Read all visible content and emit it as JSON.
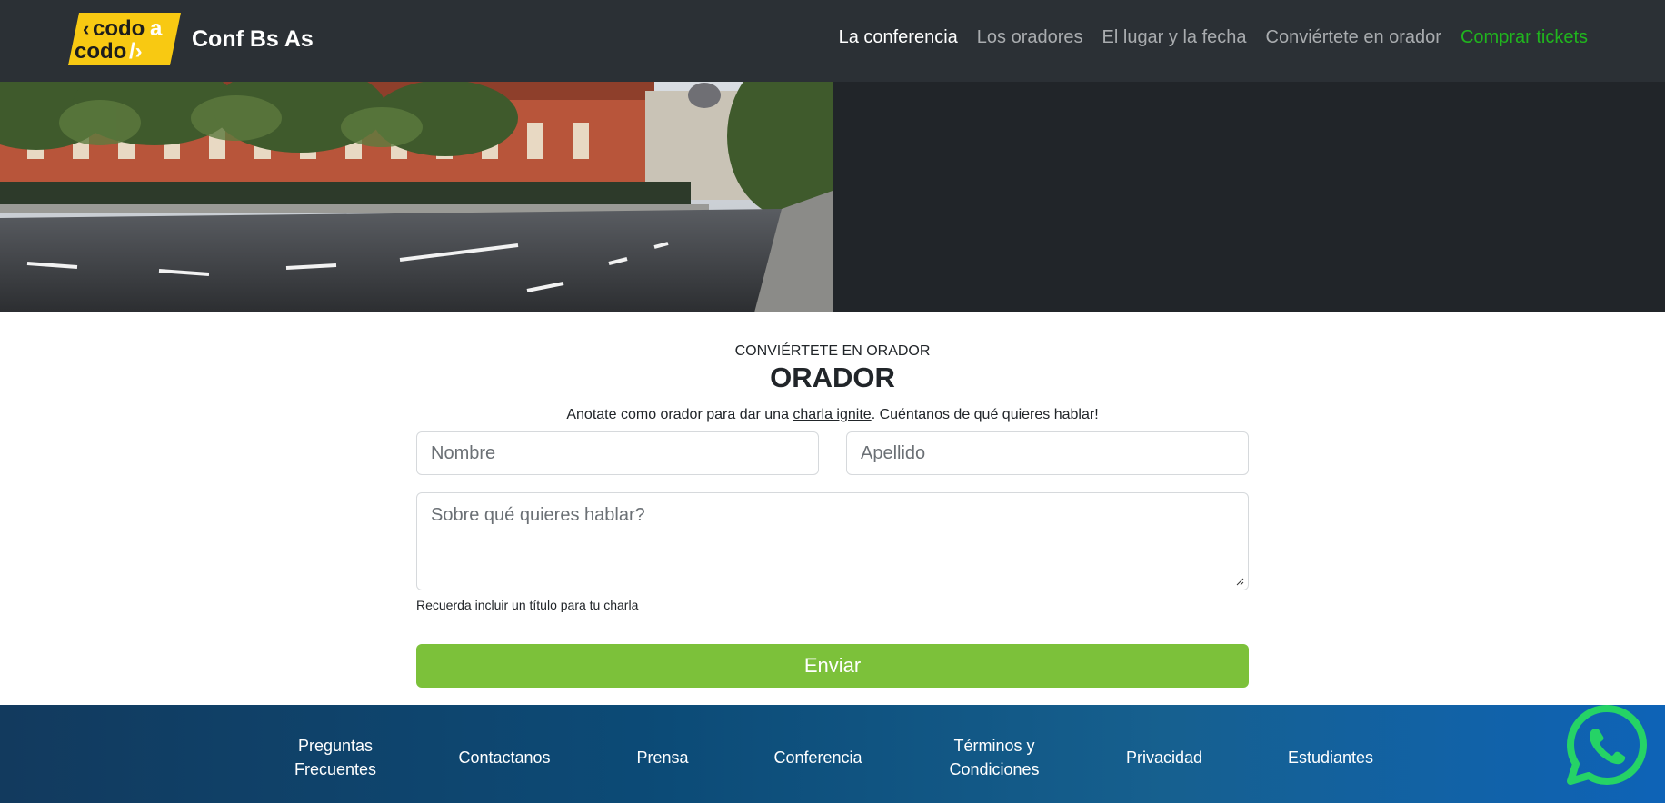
{
  "navbar": {
    "logo_line1": "codo",
    "logo_line2": "codo",
    "brand": "Conf Bs As",
    "links": [
      {
        "label": "La conferencia"
      },
      {
        "label": "Los oradores"
      },
      {
        "label": "El lugar y la fecha"
      },
      {
        "label": "Conviértete en orador"
      },
      {
        "label": "Comprar tickets"
      }
    ]
  },
  "form": {
    "overline": "Conviértete en orador",
    "title": "ORADOR",
    "intro_before": "Anotate como orador para dar una ",
    "intro_link": "charla ignite",
    "intro_after": ". Cuéntanos de qué quieres hablar!",
    "nombre_placeholder": "Nombre",
    "apellido_placeholder": "Apellido",
    "topic_placeholder": "Sobre qué quieres hablar?",
    "hint": "Recuerda incluir un título para tu charla",
    "submit": "Enviar"
  },
  "footer": {
    "links": [
      {
        "label": "Preguntas Frecuentes",
        "line1": "Preguntas",
        "line2": "Frecuentes"
      },
      {
        "label": "Contactanos"
      },
      {
        "label": "Prensa"
      },
      {
        "label": "Conferencia"
      },
      {
        "label": "Términos y Condiciones",
        "line1": "Términos y",
        "line2": "Condiciones"
      },
      {
        "label": "Privacidad"
      },
      {
        "label": "Estudiantes"
      }
    ]
  },
  "colors": {
    "navbar_bg": "#2b3035",
    "hero_bg": "#212529",
    "cta_green": "#20b51e",
    "submit_green": "#7cc13a",
    "logo_yellow": "#f8c912",
    "whatsapp_green": "#25d366"
  },
  "icons": {
    "whatsapp": "whatsapp-icon",
    "resize": "resize-grip-icon"
  }
}
